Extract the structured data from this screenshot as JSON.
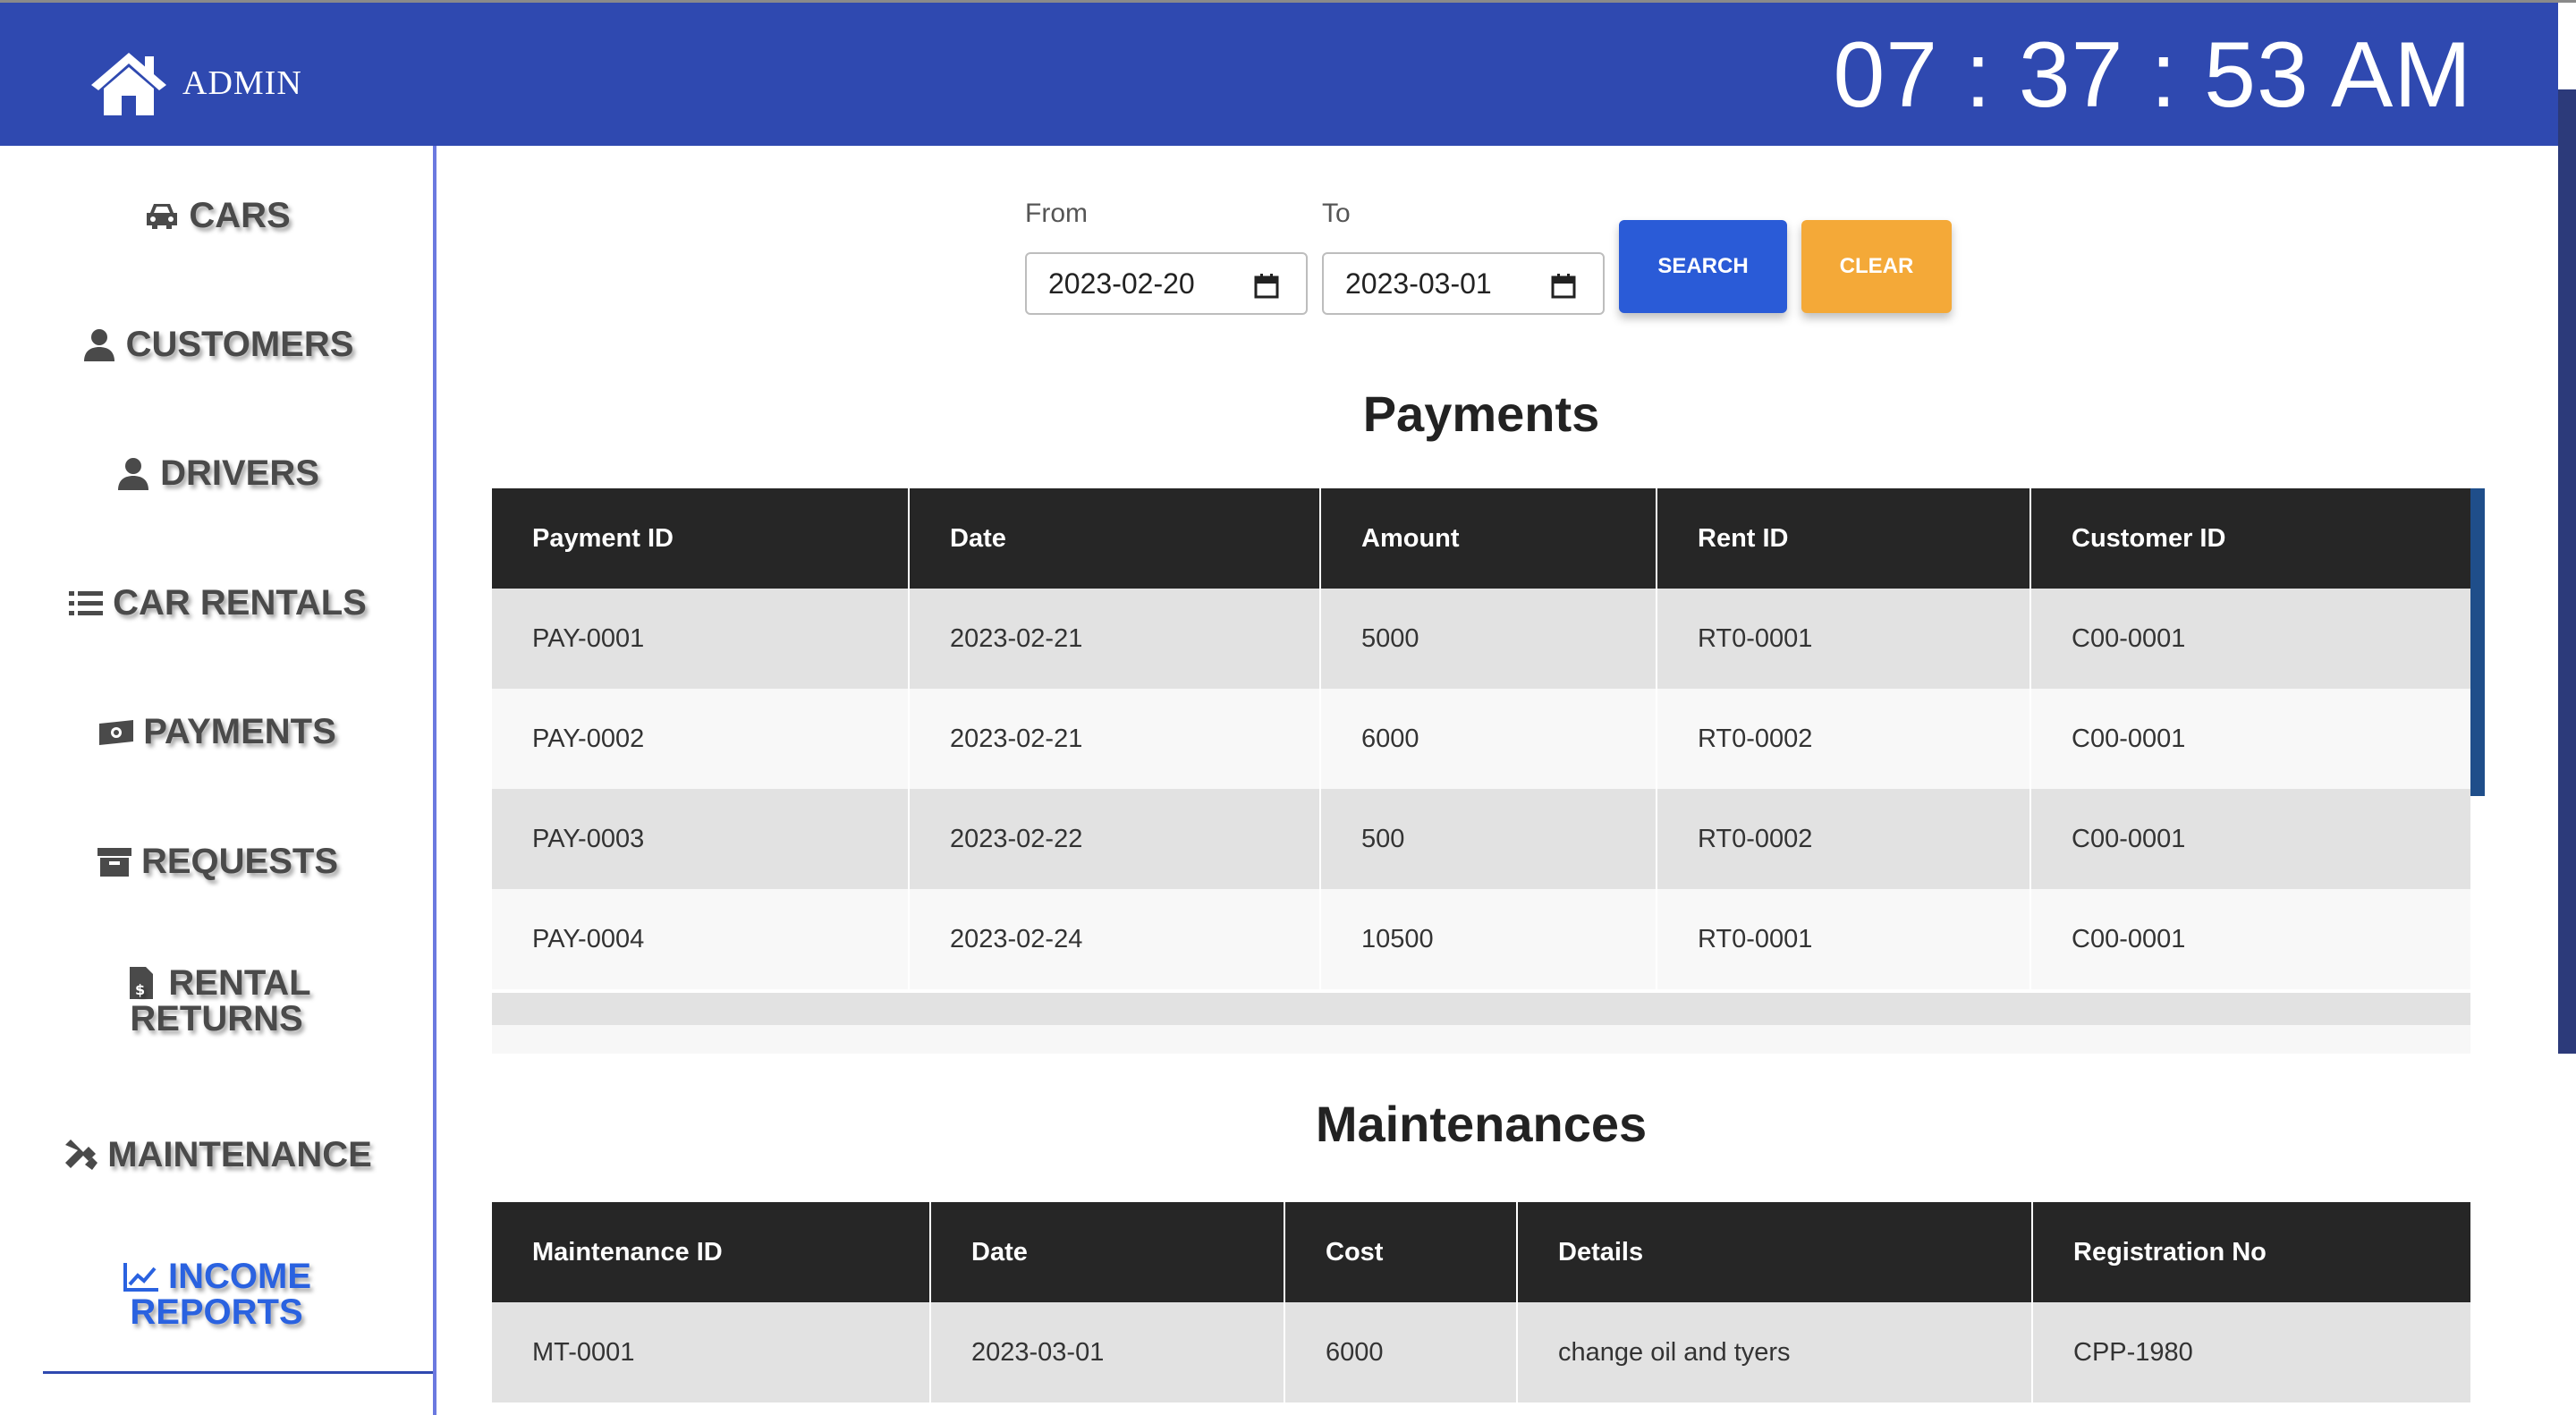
{
  "header": {
    "brand": "ADMIN",
    "clock": "07 : 37 : 53 AM"
  },
  "sidebar": {
    "items": [
      {
        "label": "CARS",
        "icon": "car-icon"
      },
      {
        "label": "CUSTOMERS",
        "icon": "user-icon"
      },
      {
        "label": "DRIVERS",
        "icon": "user-icon"
      },
      {
        "label": "CAR RENTALS",
        "icon": "list-icon"
      },
      {
        "label": "PAYMENTS",
        "icon": "money-icon"
      },
      {
        "label": "REQUESTS",
        "icon": "archive-icon"
      },
      {
        "label": "RENTAL",
        "label2": "RETURNS",
        "icon": "invoice-icon"
      },
      {
        "label": "MAINTENANCE",
        "icon": "tools-icon"
      },
      {
        "label": "INCOME",
        "label2": "REPORTS",
        "icon": "chart-line-icon",
        "active": true
      }
    ]
  },
  "filter": {
    "from_label": "From",
    "to_label": "To",
    "from_value": "2023-02-20",
    "to_value": "2023-03-01",
    "search_label": "SEARCH",
    "clear_label": "CLEAR"
  },
  "payments": {
    "title": "Payments",
    "columns": [
      "Payment ID",
      "Date",
      "Amount",
      "Rent ID",
      "Customer ID"
    ],
    "rows": [
      [
        "PAY-0001",
        "2023-02-21",
        "5000",
        "RT0-0001",
        "C00-0001"
      ],
      [
        "PAY-0002",
        "2023-02-21",
        "6000",
        "RT0-0002",
        "C00-0001"
      ],
      [
        "PAY-0003",
        "2023-02-22",
        "500",
        "RT0-0002",
        "C00-0001"
      ],
      [
        "PAY-0004",
        "2023-02-24",
        "10500",
        "RT0-0001",
        "C00-0001"
      ]
    ]
  },
  "maintenances": {
    "title": "Maintenances",
    "columns": [
      "Maintenance ID",
      "Date",
      "Cost",
      "Details",
      "Registration No"
    ],
    "rows": [
      [
        "MT-0001",
        "2023-03-01",
        "6000",
        "change oil and tyers",
        "CPP-1980"
      ]
    ]
  },
  "colors": {
    "header": "#2f49b0",
    "accent": "#2a62e0",
    "search": "#2a5bd7",
    "clear": "#f4a938"
  }
}
